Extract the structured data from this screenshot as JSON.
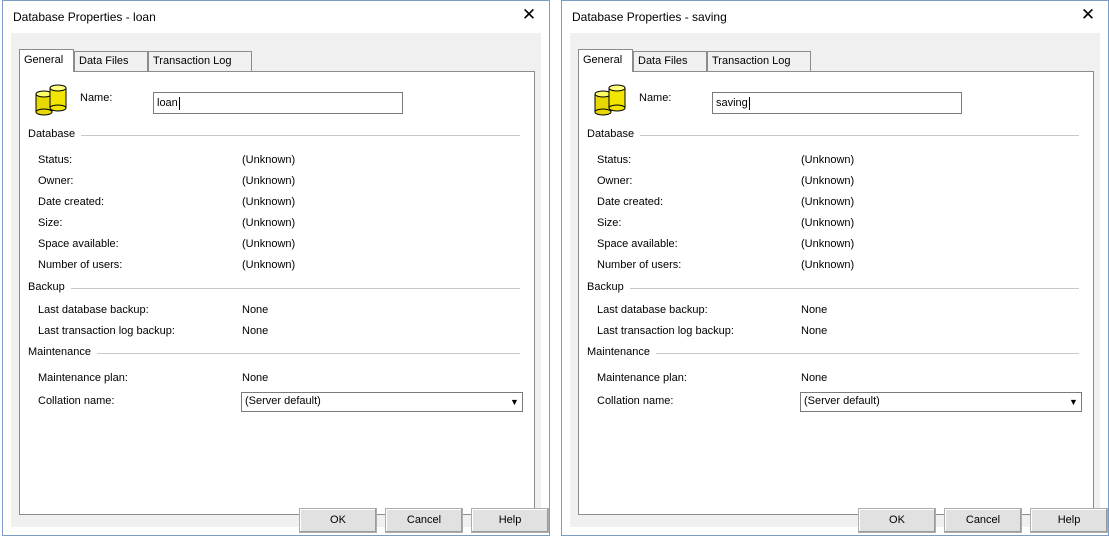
{
  "dialogs": [
    {
      "title": "Database Properties - loan",
      "close_glyph": "✕",
      "tabs": [
        "General",
        "Data Files",
        "Transaction Log"
      ],
      "name_label": "Name:",
      "name_value": "loan",
      "sections": {
        "database": "Database",
        "backup": "Backup",
        "maintenance": "Maintenance"
      },
      "database_rows": [
        {
          "label": "Status:",
          "value": "(Unknown)"
        },
        {
          "label": "Owner:",
          "value": "(Unknown)"
        },
        {
          "label": "Date created:",
          "value": "(Unknown)"
        },
        {
          "label": "Size:",
          "value": "(Unknown)"
        },
        {
          "label": "Space available:",
          "value": "(Unknown)"
        },
        {
          "label": "Number of users:",
          "value": "(Unknown)"
        }
      ],
      "backup_rows": [
        {
          "label": "Last database backup:",
          "value": "None"
        },
        {
          "label": "Last transaction log backup:",
          "value": "None"
        }
      ],
      "maintenance_plan": {
        "label": "Maintenance plan:",
        "value": "None"
      },
      "collation": {
        "label": "Collation name:",
        "value": "(Server default)"
      },
      "buttons": {
        "ok": "OK",
        "cancel": "Cancel",
        "help": "Help"
      }
    },
    {
      "title": "Database Properties - saving",
      "close_glyph": "✕",
      "tabs": [
        "General",
        "Data Files",
        "Transaction Log"
      ],
      "name_label": "Name:",
      "name_value": "saving",
      "sections": {
        "database": "Database",
        "backup": "Backup",
        "maintenance": "Maintenance"
      },
      "database_rows": [
        {
          "label": "Status:",
          "value": "(Unknown)"
        },
        {
          "label": "Owner:",
          "value": "(Unknown)"
        },
        {
          "label": "Date created:",
          "value": "(Unknown)"
        },
        {
          "label": "Size:",
          "value": "(Unknown)"
        },
        {
          "label": "Space available:",
          "value": "(Unknown)"
        },
        {
          "label": "Number of users:",
          "value": "(Unknown)"
        }
      ],
      "backup_rows": [
        {
          "label": "Last database backup:",
          "value": "None"
        },
        {
          "label": "Last transaction log backup:",
          "value": "None"
        }
      ],
      "maintenance_plan": {
        "label": "Maintenance plan:",
        "value": "None"
      },
      "collation": {
        "label": "Collation name:",
        "value": "(Server default)"
      },
      "buttons": {
        "ok": "OK",
        "cancel": "Cancel",
        "help": "Help"
      }
    }
  ]
}
